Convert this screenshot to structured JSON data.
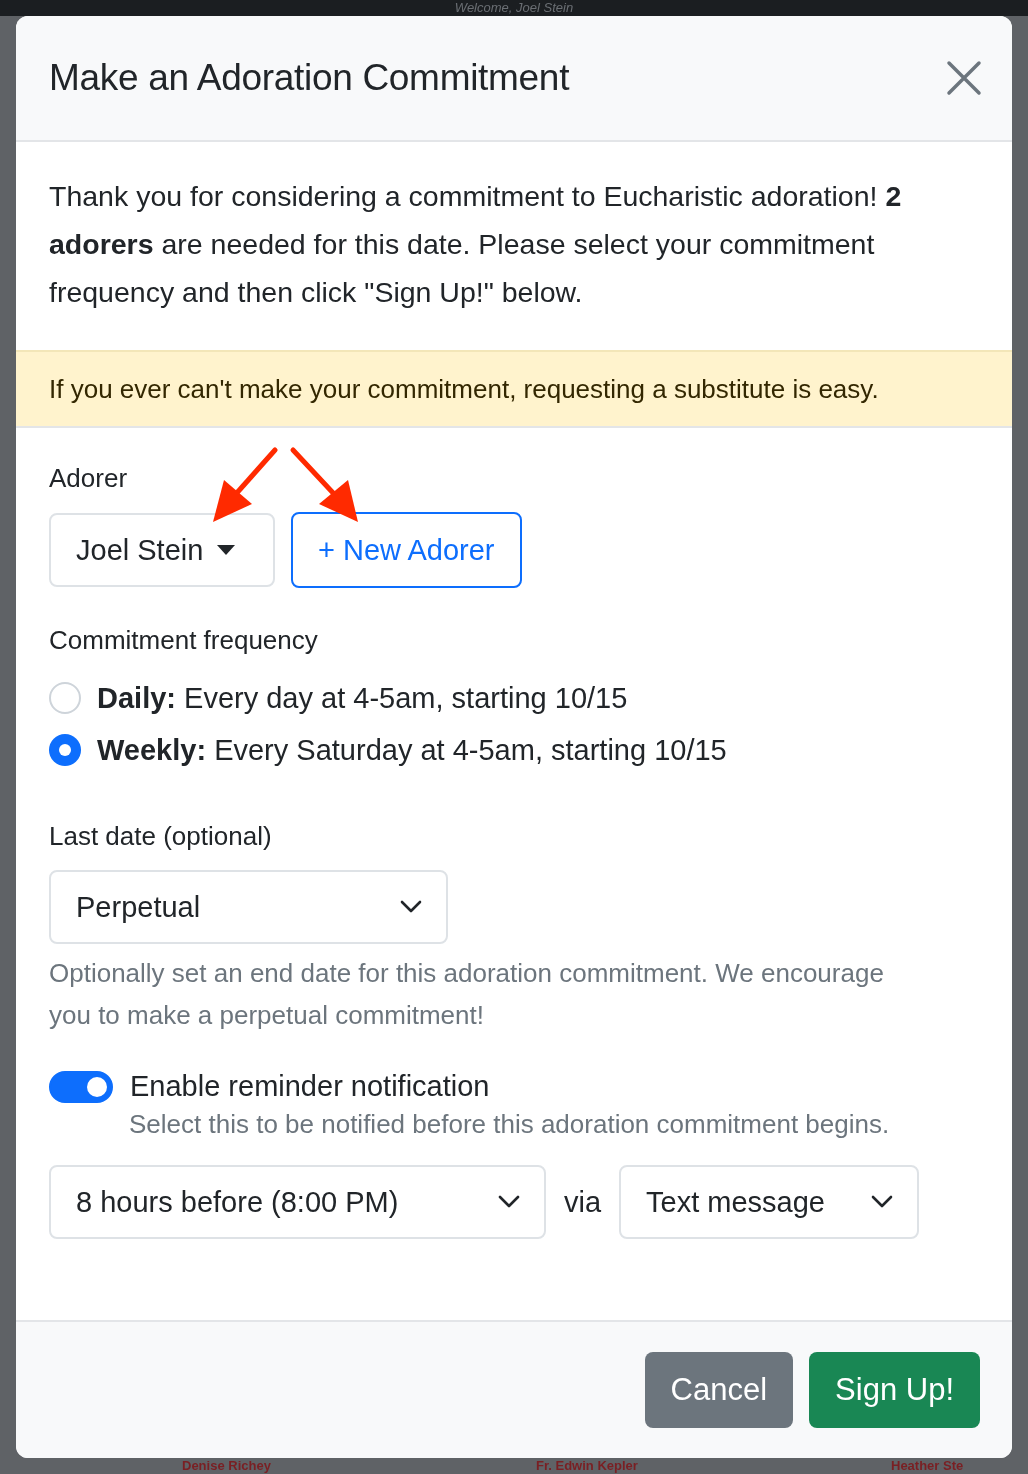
{
  "background": {
    "welcome": "Welcome, Joel Stein",
    "names": [
      "Denise Richey",
      "Fr. Edwin Kepler",
      "Heather Ste"
    ]
  },
  "modal": {
    "title": "Make an Adoration Commitment",
    "intro": "Thank you for considering a commitment to Eucharistic adoration! **2 adorers** are needed for this date. Please select your commitment frequency and then click \"Sign Up!\" below.",
    "notice": "If you ever can't make your commitment, requesting a substitute is easy.",
    "adorer": {
      "label": "Adorer",
      "value": "Joel Stein",
      "new_button": "+ New Adorer"
    },
    "frequency": {
      "label": "Commitment frequency",
      "options": [
        {
          "text": "**Daily:** Every day at 4-5am, starting 10/15",
          "selected": false
        },
        {
          "text": "**Weekly:** Every Saturday at 4-5am, starting 10/15",
          "selected": true
        }
      ]
    },
    "last_date": {
      "label": "Last date (optional)",
      "value": "Perpetual",
      "help": "Optionally set an end date for this adoration commitment. We encourage you to make a perpetual commitment!"
    },
    "reminder": {
      "label": "Enable reminder notification",
      "on": true,
      "help": "Select this to be notified before this adoration commitment begins.",
      "timing": "8 hours before (8:00 PM)",
      "via": "via",
      "method": "Text message"
    },
    "buttons": [
      {
        "label": "Cancel",
        "kind": "secondary"
      },
      {
        "label": "Sign Up!",
        "kind": "primary"
      }
    ]
  }
}
